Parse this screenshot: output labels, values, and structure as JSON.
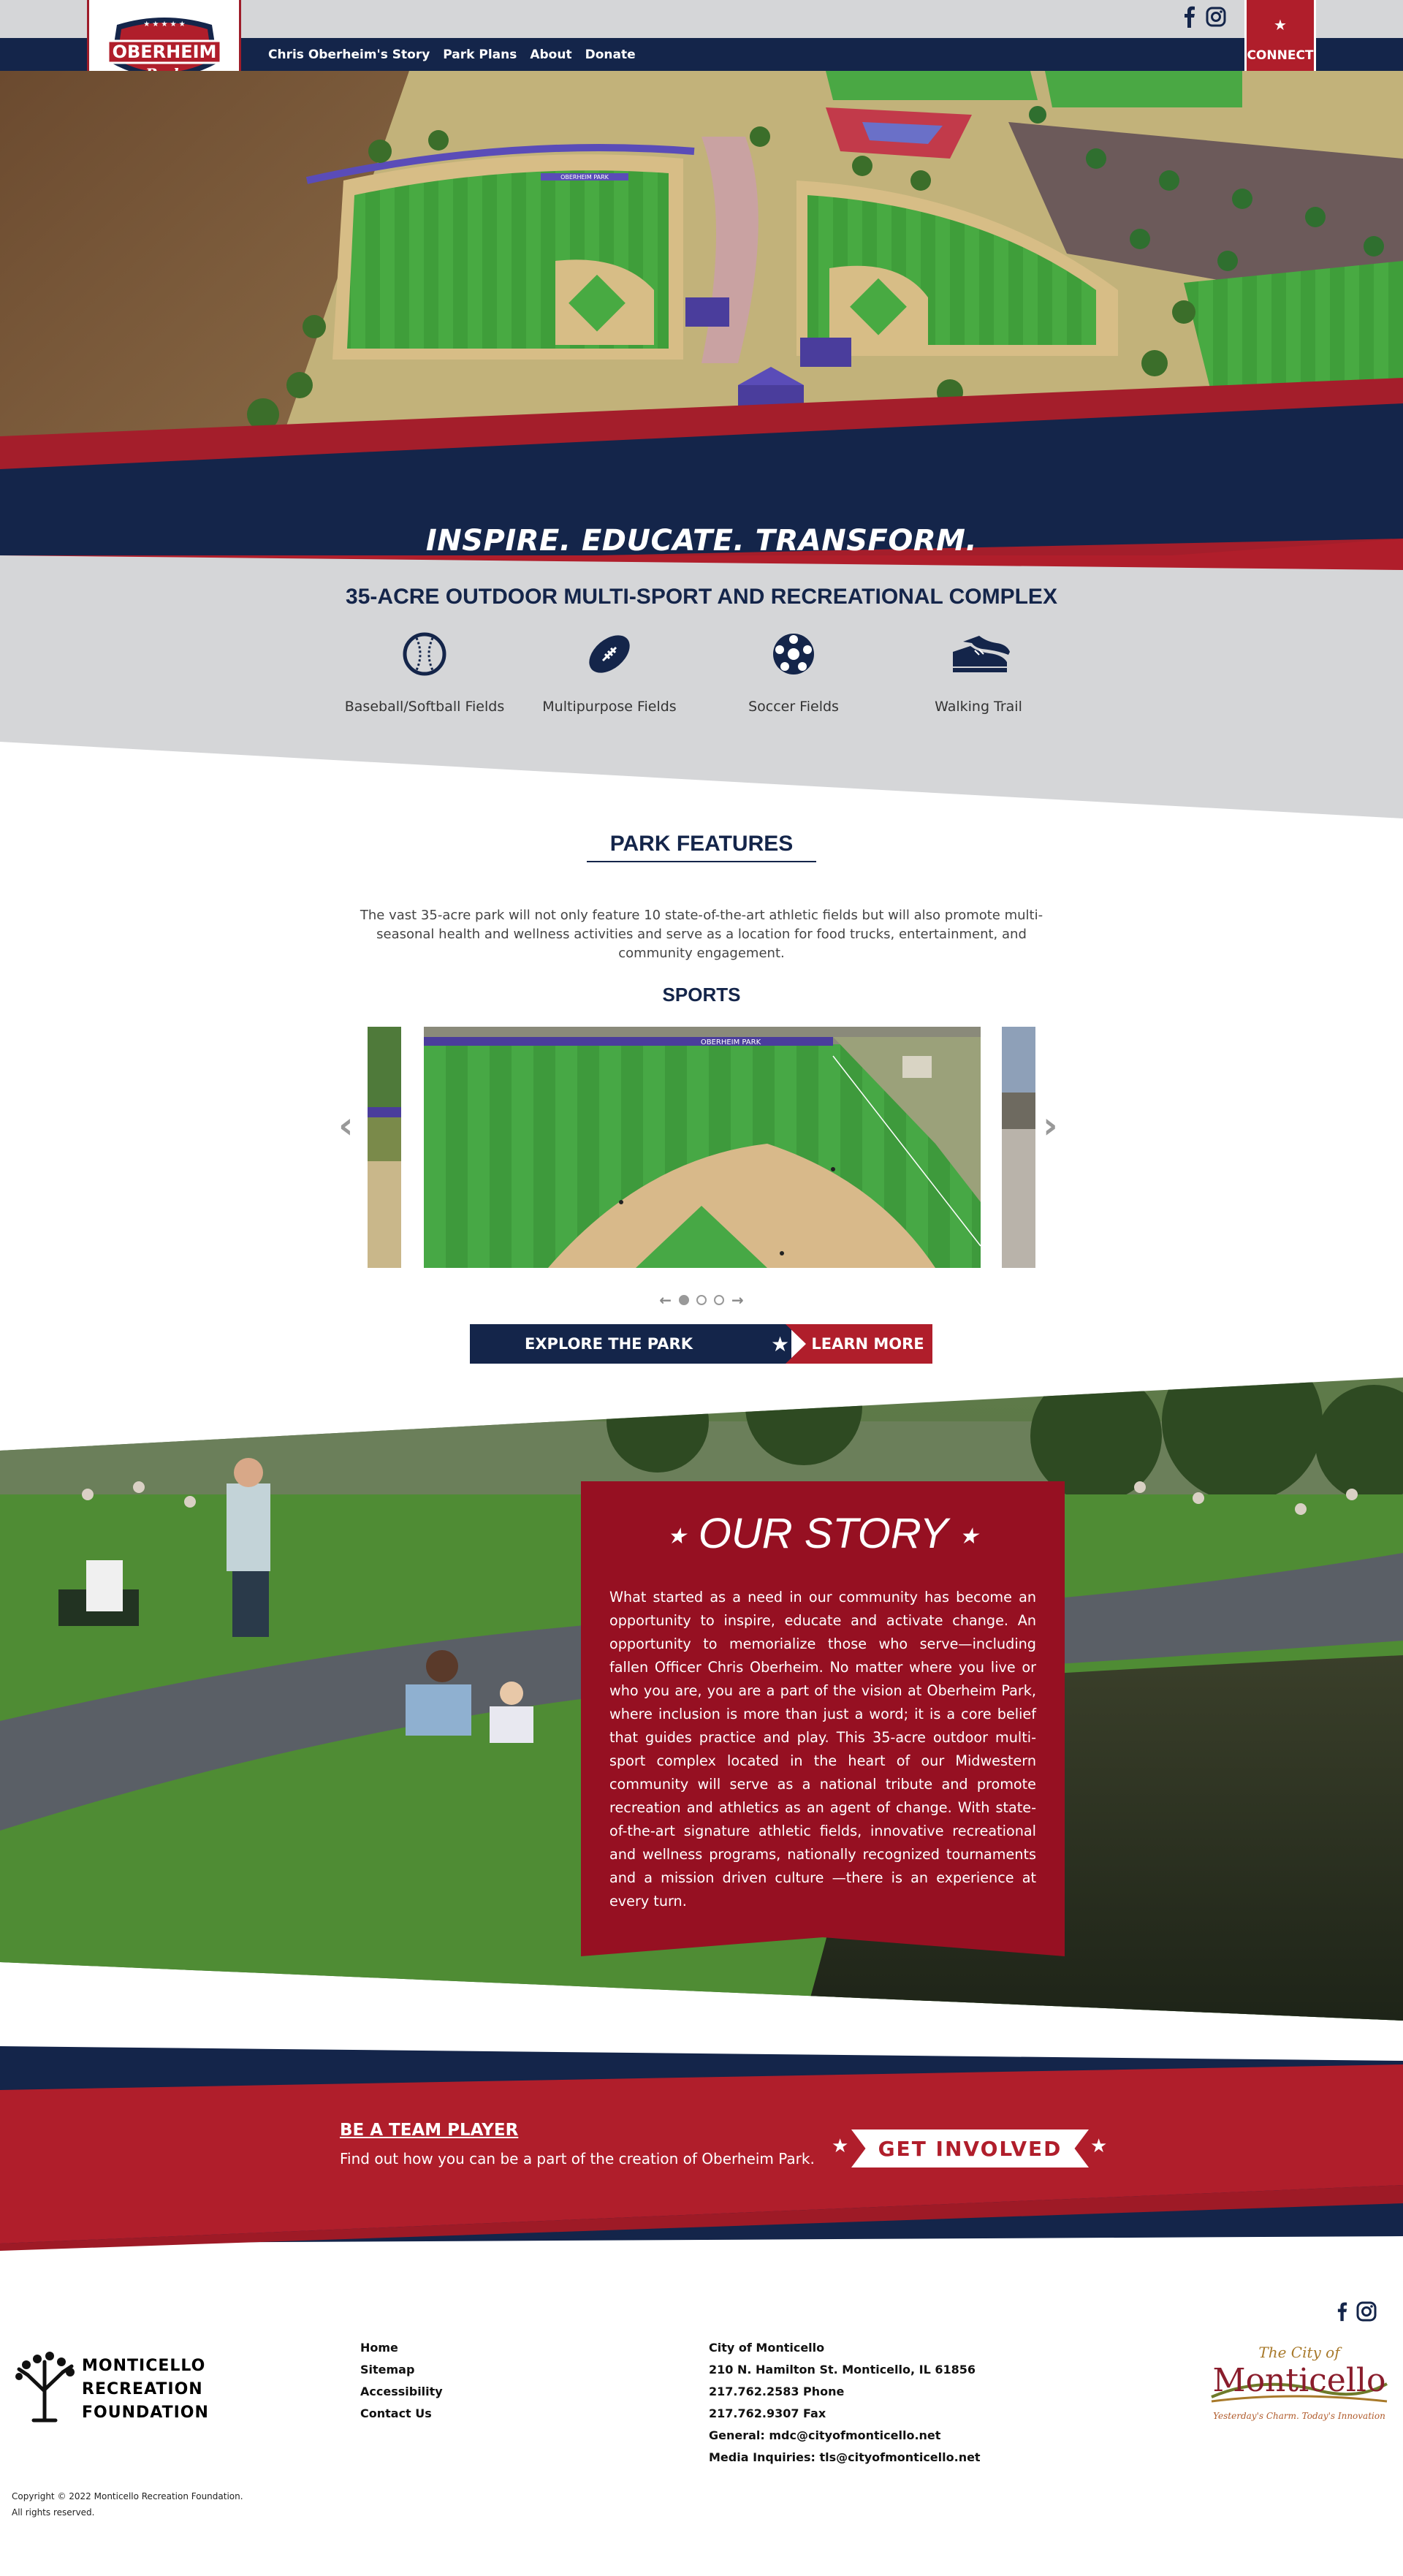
{
  "header": {
    "logo_text": {
      "line1": "OBERHEIM",
      "line2": "Park"
    },
    "nav": [
      {
        "label": "Chris Oberheim's Story"
      },
      {
        "label": "Park Plans"
      },
      {
        "label": "About"
      },
      {
        "label": "Donate"
      }
    ],
    "social_icons": [
      "facebook-icon",
      "instagram-icon"
    ],
    "connect_label": "CONNECT"
  },
  "hero": {
    "tagline": "INSPIRE. EDUCATE. TRANSFORM.",
    "field_banner": "OBERHEIM PARK"
  },
  "amenities": {
    "title": "35-ACRE OUTDOOR MULTI-SPORT AND RECREATIONAL COMPLEX",
    "items": [
      {
        "label": "Baseball/Softball Fields",
        "icon": "baseball-icon"
      },
      {
        "label": "Multipurpose Fields",
        "icon": "football-icon"
      },
      {
        "label": "Soccer Fields",
        "icon": "soccer-ball-icon"
      },
      {
        "label": "Walking Trail",
        "icon": "sneakers-icon"
      }
    ]
  },
  "park_features": {
    "title": "PARK FEATURES",
    "description": "The vast 35-acre park will not only feature 10 state-of-the-art athletic fields but will also promote multi-seasonal health and wellness activities and serve as a location for food trucks, entertainment, and community engagement.",
    "carousel": {
      "title": "SPORTS",
      "slide_banner": "OBERHEIM PARK",
      "slide_count": 3,
      "active_slide": 1
    },
    "explore_label": "EXPLORE THE PARK",
    "learn_more_label": "LEARN MORE"
  },
  "our_story": {
    "title": "OUR STORY",
    "text": "What started as a need in our community has become an opportunity to inspire, educate and activate change. An opportunity to memorialize those who serve—including fallen Officer Chris Oberheim. No matter where you live or who you are, you are a part of the vision at Oberheim Park, where inclusion is more than just a word; it is a core belief that guides practice and play. This 35-acre outdoor multi-sport complex located in the heart of our Midwestern community will serve as a national tribute and promote recreation and athletics as an agent of change. With state-of-the-art signature athletic fields, innovative recreational and wellness programs, nationally recognized tournaments and a mission driven culture —there is an experience at every turn."
  },
  "team_player": {
    "title": "BE A TEAM PLAYER",
    "text": "Find out how you can be a part of the creation of Oberheim Park.",
    "button_label": "GET INVOLVED"
  },
  "footer": {
    "mrf_logo": [
      "MONTICELLO",
      "RECREATION",
      "FOUNDATION"
    ],
    "links": [
      {
        "label": "Home"
      },
      {
        "label": "Sitemap"
      },
      {
        "label": "Accessibility"
      },
      {
        "label": "Contact Us"
      }
    ],
    "contact": [
      "City of Monticello",
      "210 N. Hamilton St. Monticello, IL 61856",
      "217.762.2583 Phone",
      "217.762.9307 Fax",
      "General: mdc@cityofmonticello.net",
      "Media Inquiries: tls@cityofmonticello.net"
    ],
    "city_logo": {
      "top": "The City of",
      "name": "Monticello",
      "tagline": "Yesterday's Charm. Today's Innovation"
    },
    "copyright": [
      "Copyright © 2022 Monticello Recreation Foundation.",
      "All rights reserved."
    ]
  },
  "colors": {
    "navy": "#14254a",
    "red": "#b01e2b",
    "dark_red": "#961022",
    "grey": "#d5d6d8"
  }
}
